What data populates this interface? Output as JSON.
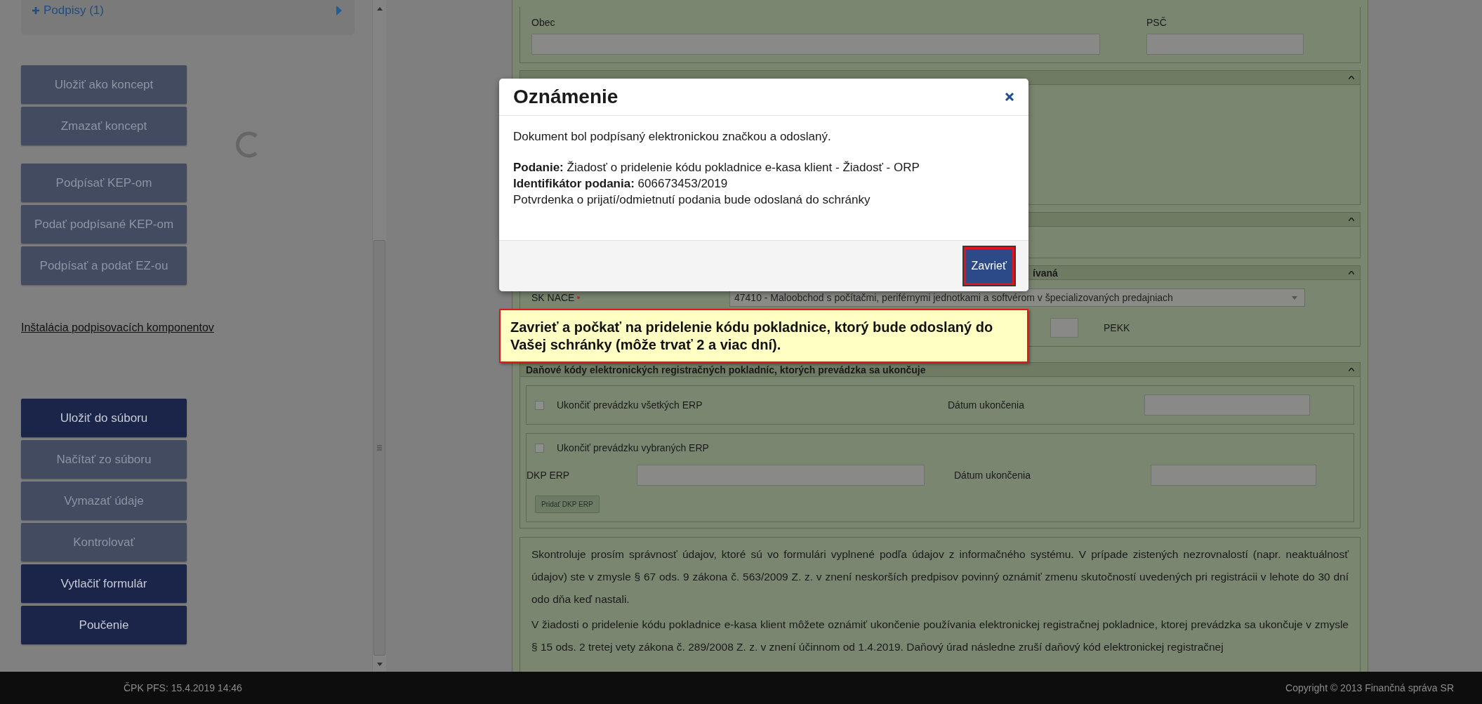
{
  "sidebar": {
    "signatures": {
      "label": "Podpisy (1)"
    },
    "draft_buttons": [
      {
        "label": "Uložiť ako koncept",
        "disabled": true
      },
      {
        "label": "Zmazať koncept",
        "disabled": true
      }
    ],
    "sign_buttons": [
      {
        "label": "Podpísať KEP-om",
        "disabled": true
      },
      {
        "label": "Podať podpísané KEP-om",
        "disabled": true
      },
      {
        "label": "Podpísať a podať EZ-ou",
        "disabled": true
      }
    ],
    "install_link": "Inštalácia podpisovacích komponentov",
    "file_buttons": [
      {
        "label": "Uložiť do súboru",
        "disabled": false
      },
      {
        "label": "Načítať zo súboru",
        "disabled": true
      },
      {
        "label": "Vymazať údaje",
        "disabled": true
      },
      {
        "label": "Kontrolovať",
        "disabled": true
      },
      {
        "label": "Vytlačiť formulár",
        "disabled": false
      },
      {
        "label": "Poučenie",
        "disabled": false
      }
    ]
  },
  "form": {
    "address_fields": [
      {
        "label": "Obec"
      },
      {
        "label": "PSČ"
      }
    ],
    "nace_section": {
      "title": "ívaná",
      "field": {
        "label": "SK NACE",
        "required": true,
        "value": "47410 - Maloobchod s počítačmi, periférnymi jednotkami a softvérom v špecializovaných predajniach"
      },
      "pekk_label": "PEKK"
    },
    "erp_section": {
      "title": "Daňové kódy elektronických registračných pokladníc, ktorých prevádzka sa ukončuje",
      "groups": [
        {
          "checkbox": {
            "label": "Ukončiť prevádzku všetkých ERP",
            "checked": false
          },
          "date_label": "Dátum ukončenia"
        },
        {
          "checkbox": {
            "label": "Ukončiť prevádzku vybraných ERP",
            "checked": false
          },
          "dkp_label": "DKP ERP",
          "date_label": "Dátum ukončenia",
          "add_button": "Pridať DKP ERP"
        }
      ]
    },
    "info_paragraphs": [
      "Skontroluje prosím správnosť údajov, ktoré sú vo formulári vyplnené podľa údajov z informačného systému. V prípade zistených nezrovnalostí (napr. neaktuálnosť údajov) ste v zmysle § 67 ods. 9 zákona č. 563/2009 Z. z. v znení neskorších predpisov povinný oznámiť zmenu skutočností uvedených pri registrácii v lehote do 30 dní odo dňa keď nastali.",
      "V žiadosti o pridelenie kódu pokladnice e-kasa klient môžete oznámiť ukončenie používania elektronickej registračnej pokladnice, ktorej prevádzka sa ukončuje v zmysle § 15 ods. 2 tretej vety zákona č. 289/2008 Z. z. v znení účinnom od 1.4.2019. Daňový úrad následne zruší daňový kód elektronickej registračnej"
    ]
  },
  "dialog": {
    "title": "Oznámenie",
    "message": "Dokument bol podpísaný elektronickou značkou a odoslaný.",
    "details": [
      "**Podanie:** Žiadosť o pridelenie kódu pokladnice e-kasa klient - Žiadosť - ORP",
      "**Identifikátor podania:** 606673453/2019",
      "Potvrdenka o prijatí/odmietnutí podania bude odoslaná do schránky"
    ],
    "close_button": "Zavrieť"
  },
  "tooltip": {
    "text": "Zavrieť a počkať na pridelenie kódu pokladnice, ktorý bude odoslaný do Vašej schránky (môže trvať 2 a viac dní)."
  },
  "footer": {
    "left": "ČPK PFS: 15.4.2019 14:46",
    "right": "Copyright © 2013 Finančná správa SR"
  }
}
